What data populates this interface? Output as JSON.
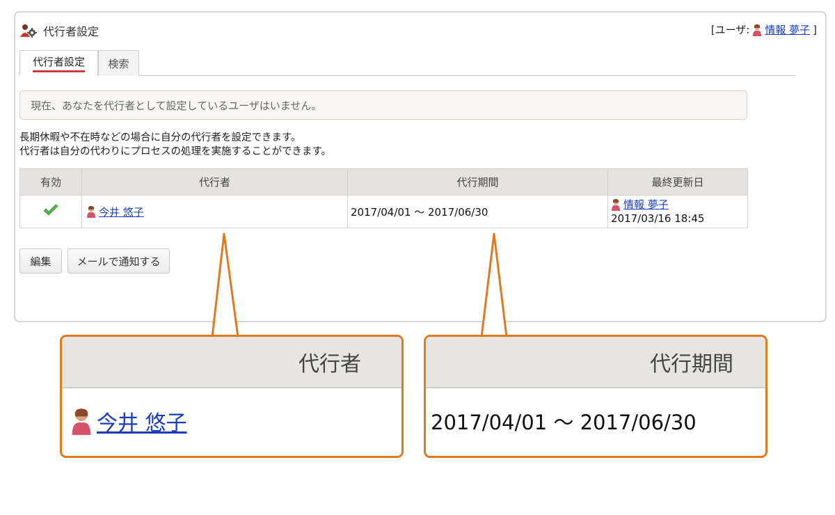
{
  "header": {
    "title": "代行者設定",
    "user_prefix": "[ユーザ:",
    "user_name": "情報 夢子",
    "user_suffix": "]"
  },
  "tabs": [
    {
      "label": "代行者設定",
      "active": true
    },
    {
      "label": "検索",
      "active": false
    }
  ],
  "notice": "現在、あなたを代行者として設定しているユーザはいません。",
  "description": [
    "長期休暇や不在時などの場合に自分の代行者を設定できます。",
    "代行者は自分の代わりにプロセスの処理を実施することができます。"
  ],
  "table": {
    "headers": [
      "有効",
      "代行者",
      "代行期間",
      "最終更新日"
    ],
    "rows": [
      {
        "valid": true,
        "proxy_name": "今井 悠子",
        "period": "2017/04/01 〜 2017/06/30",
        "updated_by": "情報 夢子",
        "updated_at": "2017/03/16 18:45"
      }
    ]
  },
  "buttons": {
    "edit": "編集",
    "notify": "メールで通知する"
  },
  "callouts": {
    "proxy_header": "代行者",
    "proxy_name": "今井 悠子",
    "period_header": "代行期間",
    "period_value": "2017/04/01 〜 2017/06/30"
  },
  "icons": {
    "header": "user-gear-icon",
    "user": "user-icon",
    "valid": "checkmark-icon"
  },
  "colors": {
    "accent_tab": "#d23c3c",
    "link": "#1a3eb8",
    "callout_border": "#e07a1f",
    "check": "#4caf50"
  }
}
